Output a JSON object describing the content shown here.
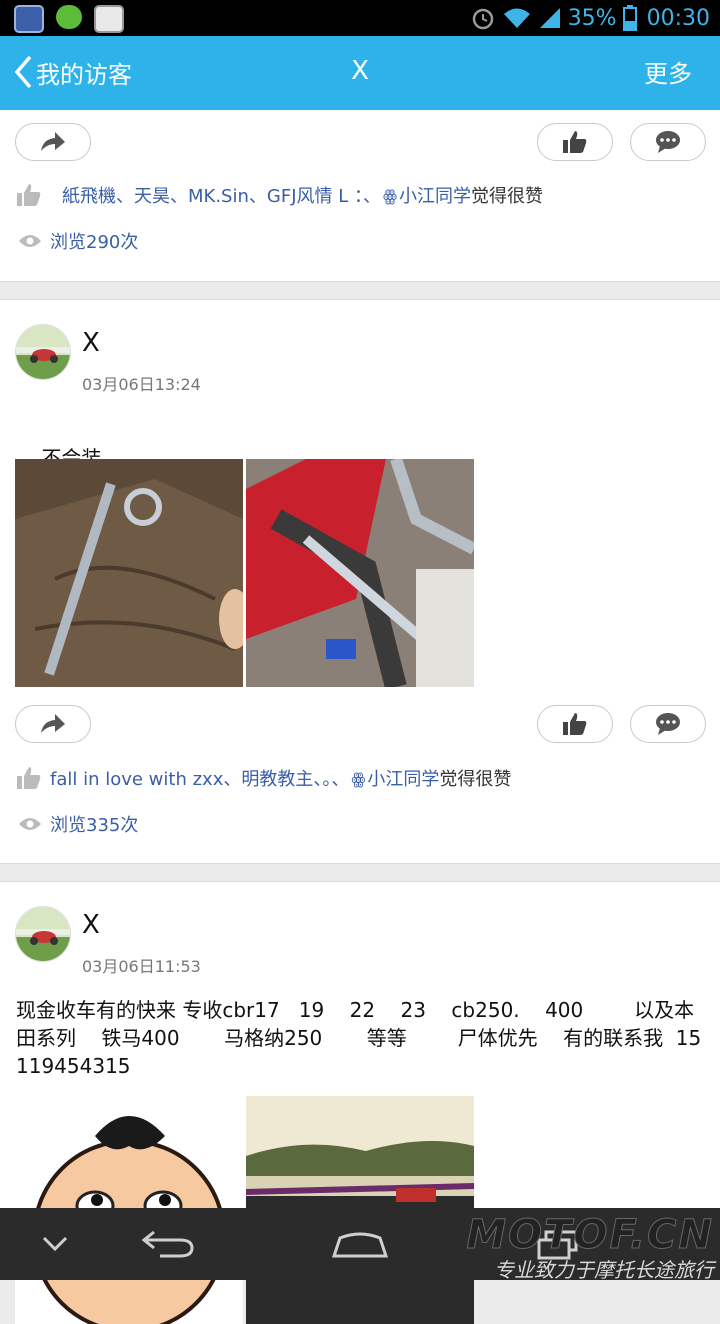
{
  "status_bar": {
    "battery": "35%",
    "time": "00:30"
  },
  "header": {
    "back_label": "我的访客",
    "title": "X",
    "more_label": "更多"
  },
  "posts": [
    {
      "likes_names": "紙飛機、天昊、MK.Sin、GFJ风情 L ：、",
      "likes_last": "小江同学",
      "likes_suffix": "觉得很赞",
      "views": "浏览290次"
    },
    {
      "author": "X",
      "time": "03月06日13:24",
      "text": "不会装",
      "likes_names": "fall in love with zxx、明教教主、。、",
      "likes_last": "小江同学",
      "likes_suffix": "觉得很赞",
      "views": "浏览335次"
    },
    {
      "author": "X",
      "time": "03月06日11:53",
      "text": "现金收车有的快来 专收cbr17   19    22    23    cb250.    400        以及本田系列    铁马400       马格纳250       等等        尸体优先    有的联系我  15119454315"
    }
  ],
  "watermark": {
    "brand": "MOTOF.CN",
    "slogan": "专业致力于摩托长途旅行"
  },
  "colors": {
    "accent": "#2db3e9",
    "link": "#3a5ea8",
    "status_bar": "#000000",
    "nav_bar": "#2b2b2b"
  },
  "icons": [
    "shield-icon",
    "wechat-icon",
    "gallery-icon",
    "alarm-icon",
    "wifi-icon",
    "signal-icon",
    "battery-icon",
    "chevron-left-icon",
    "share-icon",
    "thumbs-up-icon",
    "comment-icon",
    "eye-icon",
    "laugh-emoji-icon",
    "nav-down-icon",
    "nav-back-icon",
    "nav-home-icon",
    "nav-recent-icon"
  ]
}
